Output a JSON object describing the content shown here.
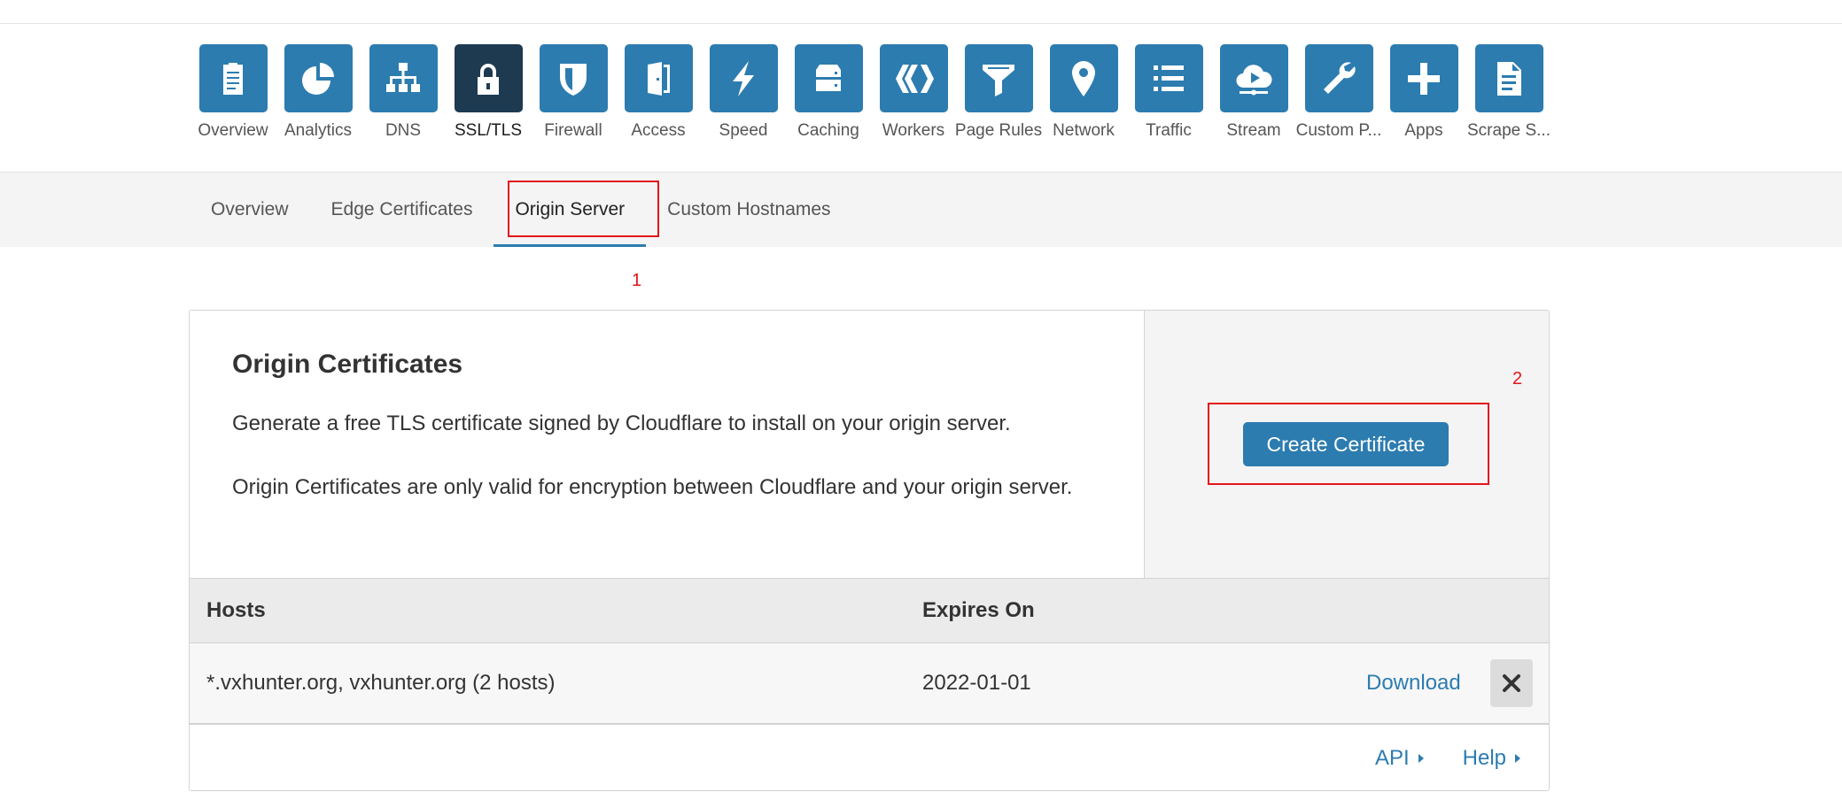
{
  "apps": [
    {
      "label": "Overview",
      "icon": "clipboard-icon",
      "active": false
    },
    {
      "label": "Analytics",
      "icon": "pie-chart-icon",
      "active": false
    },
    {
      "label": "DNS",
      "icon": "network-tree-icon",
      "active": false
    },
    {
      "label": "SSL/TLS",
      "icon": "lock-icon",
      "active": true
    },
    {
      "label": "Firewall",
      "icon": "shield-icon",
      "active": false
    },
    {
      "label": "Access",
      "icon": "door-icon",
      "active": false
    },
    {
      "label": "Speed",
      "icon": "lightning-icon",
      "active": false
    },
    {
      "label": "Caching",
      "icon": "server-drive-icon",
      "active": false
    },
    {
      "label": "Workers",
      "icon": "workers-icon",
      "active": false
    },
    {
      "label": "Page Rules",
      "icon": "funnel-icon",
      "active": false
    },
    {
      "label": "Network",
      "icon": "location-pin-icon",
      "active": false
    },
    {
      "label": "Traffic",
      "icon": "list-icon",
      "active": false
    },
    {
      "label": "Stream",
      "icon": "cloud-play-icon",
      "active": false
    },
    {
      "label": "Custom P...",
      "icon": "wrench-icon",
      "active": false
    },
    {
      "label": "Apps",
      "icon": "plus-icon",
      "active": false
    },
    {
      "label": "Scrape S...",
      "icon": "document-icon",
      "active": false
    }
  ],
  "subtabs": [
    {
      "label": "Overview",
      "active": false
    },
    {
      "label": "Edge Certificates",
      "active": false
    },
    {
      "label": "Origin Server",
      "active": true
    },
    {
      "label": "Custom Hostnames",
      "active": false
    }
  ],
  "annotations": {
    "step1": "1",
    "step2": "2"
  },
  "card": {
    "title": "Origin Certificates",
    "desc1": "Generate a free TLS certificate signed by Cloudflare to install on your origin server.",
    "desc2": "Origin Certificates are only valid for encryption between Cloudflare and your origin server.",
    "create_label": "Create Certificate"
  },
  "table": {
    "headers": {
      "hosts": "Hosts",
      "expires": "Expires On"
    },
    "rows": [
      {
        "hosts": "*.vxhunter.org, vxhunter.org (2 hosts)",
        "expires": "2022-01-01",
        "download": "Download"
      }
    ]
  },
  "footer": {
    "api": "API",
    "help": "Help"
  },
  "colors": {
    "accent": "#2c7cb0",
    "active_app": "#1d3a51",
    "highlight": "#e2161b"
  }
}
